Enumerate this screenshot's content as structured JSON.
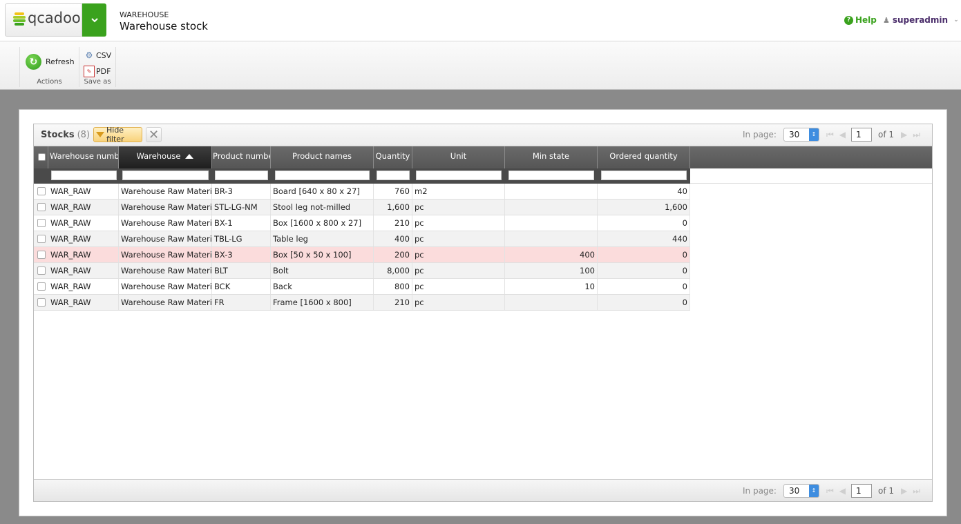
{
  "header": {
    "logo_text": "qcadoo",
    "breadcrumb_parent": "WAREHOUSE",
    "page_title": "Warehouse stock",
    "help_label": "Help",
    "user_name": "superadmin"
  },
  "ribbon": {
    "actions": {
      "label": "Actions",
      "refresh_label": "Refresh"
    },
    "save_as": {
      "label": "Save as",
      "csv_label": "CSV",
      "pdf_label": "PDF"
    }
  },
  "grid": {
    "title": "Stocks",
    "count": "(8)",
    "hide_filter_label": "Hide filter",
    "pager": {
      "in_page_label": "In page:",
      "page_size": "30",
      "current_page": "1",
      "of_label": "of 1"
    },
    "columns": [
      "Warehouse numbe",
      "Warehouse",
      "Product numbe",
      "Product names",
      "Quantity",
      "Unit",
      "Min state",
      "Ordered quantity"
    ],
    "sorted_column": "Warehouse",
    "rows": [
      [
        "WAR_RAW",
        "Warehouse Raw Materials",
        "BR-3",
        "Board [640 x 80 x 27]",
        "760",
        "m2",
        "",
        "40"
      ],
      [
        "WAR_RAW",
        "Warehouse Raw Materials",
        "STL-LG-NM",
        "Stool leg not-milled",
        "1,600",
        "pc",
        "",
        "1,600"
      ],
      [
        "WAR_RAW",
        "Warehouse Raw Materials",
        "BX-1",
        "Box [1600 x 800 x 27]",
        "210",
        "pc",
        "",
        "0"
      ],
      [
        "WAR_RAW",
        "Warehouse Raw Materials",
        "TBL-LG",
        "Table leg",
        "400",
        "pc",
        "",
        "440"
      ],
      [
        "WAR_RAW",
        "Warehouse Raw Materials",
        "BX-3",
        "Box [50 x 50 x 100]",
        "200",
        "pc",
        "400",
        "0"
      ],
      [
        "WAR_RAW",
        "Warehouse Raw Materials",
        "BLT",
        "Bolt",
        "8,000",
        "pc",
        "100",
        "0"
      ],
      [
        "WAR_RAW",
        "Warehouse Raw Materials",
        "BCK",
        "Back",
        "800",
        "pc",
        "10",
        "0"
      ],
      [
        "WAR_RAW",
        "Warehouse Raw Materials",
        "FR",
        "Frame [1600 x 800]",
        "210",
        "pc",
        "",
        "0"
      ]
    ],
    "highlighted_row": 4
  },
  "colors": {
    "brand_green": "#3aa21d",
    "highlight_row": "#fbdcdc",
    "header_dark": "#484848"
  }
}
